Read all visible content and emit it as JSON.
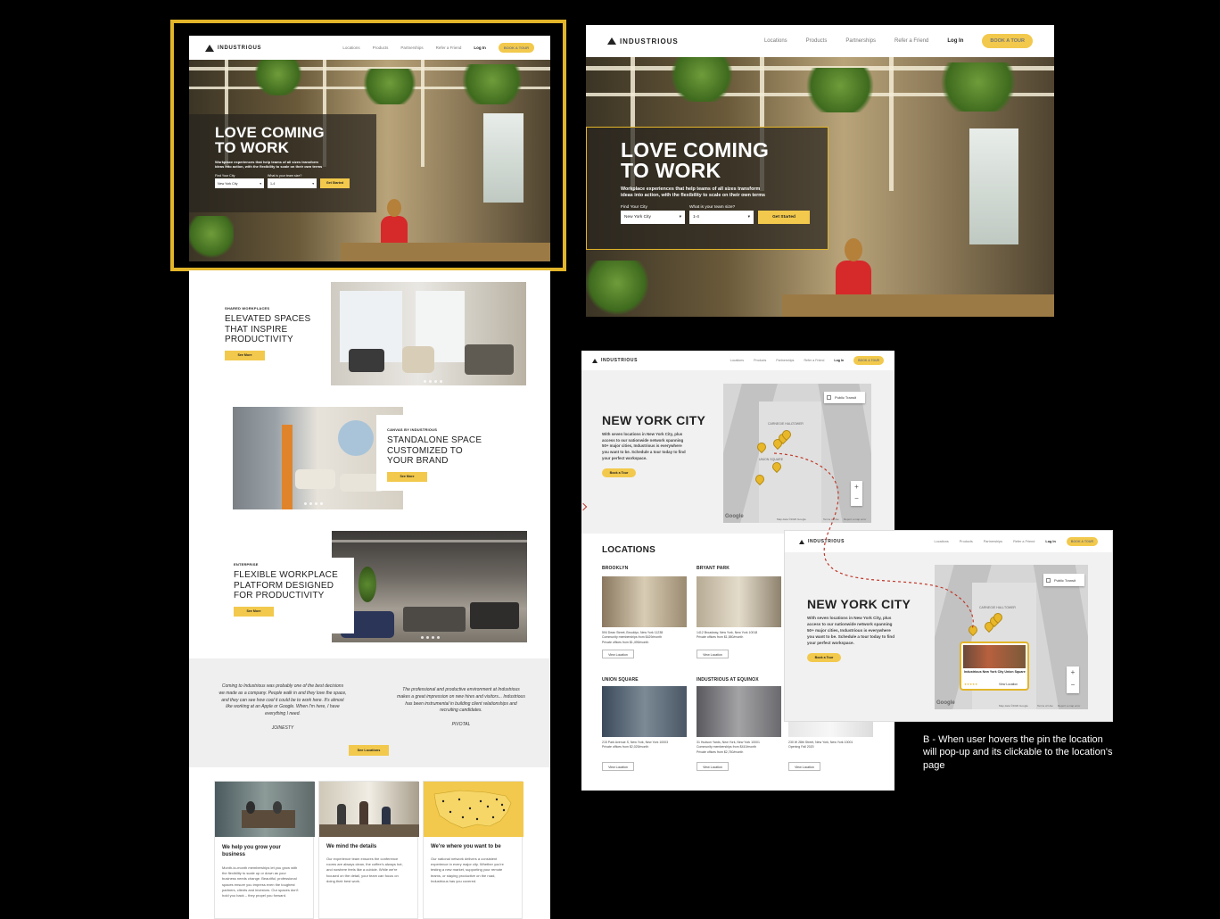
{
  "brand": {
    "logo_text": "INDUSTRIOUS",
    "accent": "#f2c94c",
    "highlight_border": "#e2b52a"
  },
  "nav": {
    "items": [
      "Locations",
      "Products",
      "Partnerships",
      "Refer a Friend"
    ],
    "login": "Log In",
    "cta": "BOOK A TOUR"
  },
  "hero": {
    "title_line1": "LOVE COMING",
    "title_line2": "TO WORK",
    "subtitle_line1": "Workplace experiences that help teams of all sizes transform",
    "subtitle_line2": "ideas into action, with the flexibility to scale on their own terms",
    "city_label": "Find Your City",
    "city_value": "New York City",
    "team_label": "What is your team size?",
    "team_value": "1-4",
    "cta": "Get Started"
  },
  "sections": [
    {
      "eyebrow": "SHARED WORKPLACES",
      "line1": "ELEVATED SPACES",
      "line2": "THAT INSPIRE",
      "line3": "PRODUCTIVITY",
      "cta": "See More"
    },
    {
      "eyebrow": "CANVAS BY INDUSTRIOUS",
      "line1": "STANDALONE SPACE",
      "line2": "CUSTOMIZED TO",
      "line3": "YOUR BRAND",
      "cta": "See More"
    },
    {
      "eyebrow": "ENTERPRISE",
      "line1": "FLEXIBLE WORKPLACE",
      "line2": "PLATFORM DESIGNED",
      "line3": "FOR PRODUCTIVITY",
      "cta": "See More"
    }
  ],
  "testimonials": [
    {
      "lines": [
        "Coming to Industrious was probably one of the best decisions",
        "we made as a company. People walk in and they love the space,",
        "and they can see how cool it could be to work here. It's almost",
        "like working at an Apple or Google. When I'm here, I have",
        "everything I need."
      ],
      "author": "JOINESTY"
    },
    {
      "lines": [
        "The professional and productive environment at Industrious",
        "makes a great impression on new hires and visitors... Industrious",
        "has been instrumental in building client relationships and",
        "recruiting candidates."
      ],
      "author": "PIVOTAL"
    }
  ],
  "testimonial_cta": "See Locations",
  "features": [
    {
      "title_line1": "We help you grow your",
      "title_line2": "business",
      "body": [
        "Month-to-month memberships let you grow with",
        "the flexibility to scale up or down as your",
        "business needs change. Beautiful, professional",
        "spaces ensure you impress even the toughest",
        "partners, clients and investors. Our spaces don't",
        "hold you back – they propel you forward."
      ]
    },
    {
      "title_line1": "We mind the details",
      "title_line2": "",
      "body": [
        "Our experience team ensures the conference",
        "rooms are always clean, the coffee's always hot,",
        "and nowhere feels like a cubicle. While we're",
        "focused on the detail, your team can focus on",
        "doing their best work."
      ]
    },
    {
      "title_line1": "We're where you want to be",
      "title_line2": "",
      "body": [
        "Our national network delivers a consistent",
        "experience in every major city. Whether you're",
        "testing a new market, supporting your remote",
        "teams, or staying productive on the road,",
        "Industrious has you covered."
      ]
    }
  ],
  "city_page": {
    "title": "NEW YORK CITY",
    "body": [
      "With seven locations in New York City, plus",
      "access to our nationwide network spanning",
      "50+ major cities, Industrious is everywhere",
      "you want to be. Schedule a tour today to find",
      "your perfect workspace."
    ],
    "cta": "Book a Tour",
    "transit": "Public Transit",
    "map_labels": [
      "CARNEGIE HALL",
      "TOWER",
      "UNION SQUARE",
      "MANHATTAN"
    ],
    "map_footer": "Map data ©2020 Google",
    "map_terms": "Terms of Use",
    "map_report": "Report a map error",
    "google": "Google",
    "locations_title": "LOCATIONS",
    "locations": [
      {
        "name": "BROOKLYN",
        "addr": "594 Dean Street, Brooklyn, New York 11238",
        "line2": "Community memberships from $429/month",
        "line3": "Private offices from $1,495/month",
        "cta": "View Location"
      },
      {
        "name": "BRYANT PARK",
        "addr": "1412 Broadway, New York, New York 10018",
        "line2": "Private offices from $1,580/month",
        "line3": "",
        "cta": "View Location"
      },
      {
        "name": "UNION SQUARE",
        "addr": "215 Park Avenue S, New York, New York 10003",
        "line2": "Private offices from $2,025/month",
        "line3": "",
        "cta": "View Location"
      },
      {
        "name": "INDUSTRIOUS AT EQUINOX",
        "addr": "31 Hudson Yards, New York, New York 10001",
        "line2": "Community memberships from $410/month",
        "line3": "Private offices from $2,760/month",
        "cta": "View Location"
      },
      {
        "name": "",
        "addr": "230 W 28th Street, New York, New York 10001",
        "line2": "Opening Fall 2020",
        "line3": "",
        "cta": "View Location"
      }
    ],
    "popup_title": "Industrious New York City Union Square",
    "popup_rating": "★★★★★",
    "popup_link": "View Location"
  },
  "annotation": {
    "line1": "B - When user hovers the pin the location",
    "line2": "will pop-up and its clickable to the location's",
    "line3": "page"
  }
}
